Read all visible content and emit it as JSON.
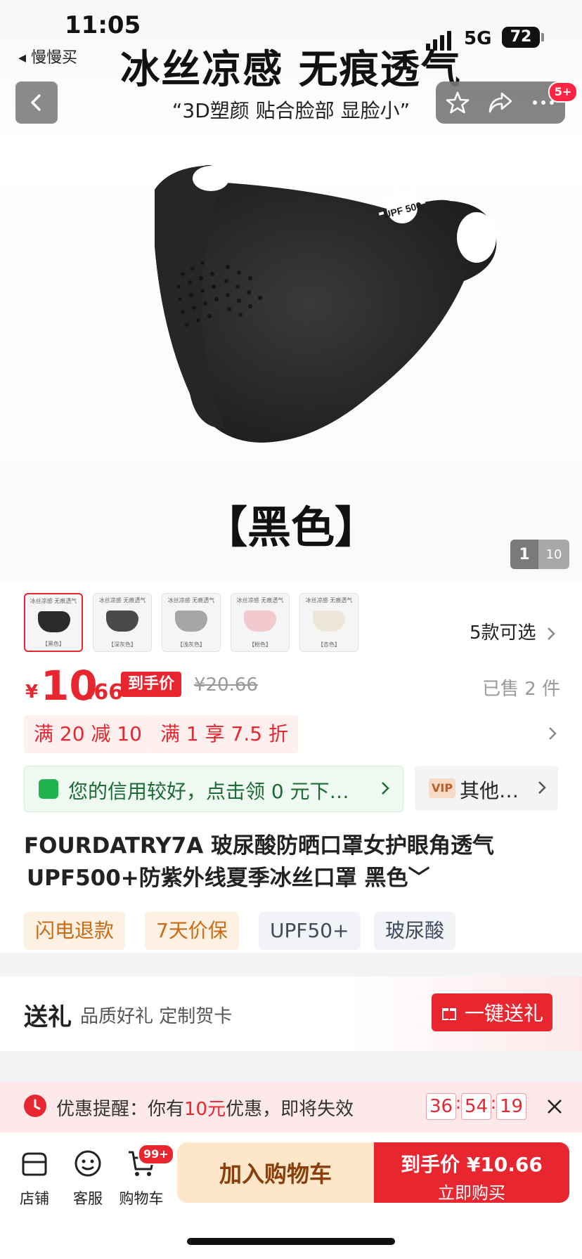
{
  "status_bar": {
    "time": "11:05",
    "back_app": "◂ 慢慢买",
    "network": "5G",
    "battery": "72"
  },
  "hero": {
    "promo_title": "冰丝凉感 无痕透气",
    "promo_subtitle": "“3D塑颜 贴合脸部 显脸小”",
    "upf_badge": "UPF 500",
    "color_caption": "【黑色】",
    "pager_current": "1",
    "pager_total": "10",
    "cart_badge_count": "5+"
  },
  "thumbnails": [
    {
      "top": "冰丝凉感 无痕透气",
      "bottom": "【黑色】",
      "color": "#2b2b2b",
      "selected": true
    },
    {
      "top": "冰丝凉感 无痕透气",
      "bottom": "【深灰色】",
      "color": "#4a4a4a",
      "selected": false
    },
    {
      "top": "冰丝凉感 无痕透气",
      "bottom": "【浅灰色】",
      "color": "#a6a6a6",
      "selected": false
    },
    {
      "top": "冰丝凉感 无痕透气",
      "bottom": "【粉色】",
      "color": "#f2c9cf",
      "selected": false
    },
    {
      "top": "冰丝凉感 无痕透气",
      "bottom": "【杏色】",
      "color": "#ebe6d6",
      "selected": false
    }
  ],
  "variants_text": "5款可选",
  "price": {
    "currency": "¥",
    "integer": "10",
    "decimal": ".66",
    "tag": "到手价",
    "original": "¥20.66",
    "sold": "已售 2 件"
  },
  "coupons": [
    "满 20 减 10",
    "满 1 享 7.5 折"
  ],
  "credit_banner": "您的信用较好，点击领 0 元下…",
  "vip": {
    "tag": "VIP",
    "text": "其他…"
  },
  "product_title": {
    "line1": "FOURDATRY7A 玻尿酸防晒口罩女护眼角透气",
    "line2": "UPF500+防紫外线夏季冰丝口罩 黑色﹀"
  },
  "tags": [
    "闪电退款",
    "7天价保",
    "UPF50+",
    "玻尿酸"
  ],
  "gift": {
    "title": "送礼",
    "subtitle": "品质好礼 定制贺卡",
    "button": "一键送礼"
  },
  "reminder": {
    "prefix": "优惠提醒：你有",
    "amount": "10元",
    "suffix": "优惠，即将失效",
    "hours": "36",
    "minutes": "54",
    "seconds": "19"
  },
  "bottom_nav": {
    "store": "店铺",
    "service": "客服",
    "cart": "购物车",
    "cart_badge": "99+",
    "add_to_cart": "加入购物车",
    "buy_line1": "到手价 ¥10.66",
    "buy_line2": "立即购买"
  },
  "colors": {
    "accent": "#e8262f",
    "credit_green": "#1fb24d"
  }
}
